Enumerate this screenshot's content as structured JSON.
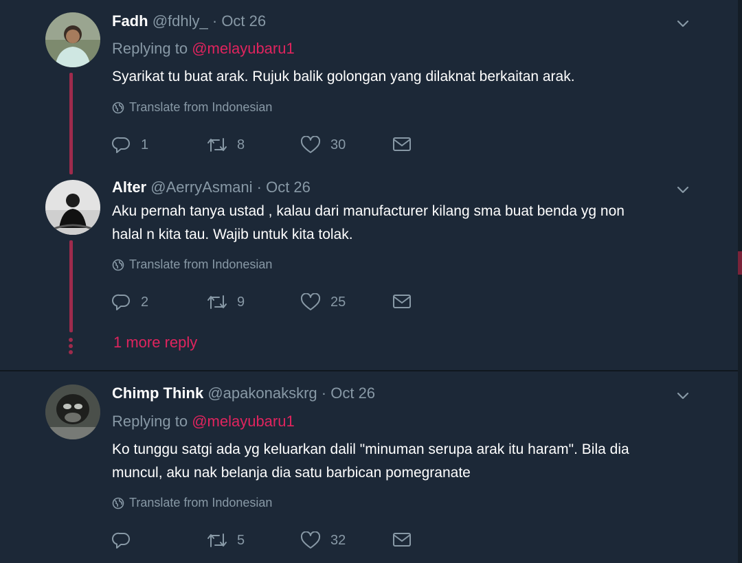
{
  "tweets": [
    {
      "name": "Fadh",
      "handle": "@fdhly_",
      "sep": "·",
      "date": "Oct 26",
      "replying_prefix": "Replying to ",
      "replying_to": "@melayubaru1",
      "text": "Syarikat tu buat arak. Rujuk balik golongan yang dilaknat berkaitan arak.",
      "translate": "Translate from Indonesian",
      "replies": "1",
      "retweets": "8",
      "likes": "30"
    },
    {
      "name": "Alter",
      "handle": "@AerryAsmani",
      "sep": "·",
      "date": "Oct 26",
      "text_line1": "Aku pernah tanya ustad , kalau dari manufacturer  kilang sma buat benda yg non",
      "text_line2": "halal n kita tau. Wajib untuk kita tolak.",
      "translate": "Translate from Indonesian",
      "replies": "2",
      "retweets": "9",
      "likes": "25"
    },
    {
      "name": "Chimp Think",
      "handle": "@apakonakskrg",
      "sep": "·",
      "date": "Oct 26",
      "replying_prefix": "Replying to ",
      "replying_to": "@melayubaru1",
      "text_line1": "Ko tunggu satgi ada yg keluarkan dalil \"minuman serupa arak itu haram\". Bila dia",
      "text_line2": "muncul, aku nak belanja dia satu barbican pomegranate",
      "translate": "Translate from Indonesian",
      "replies": "",
      "retweets": "5",
      "likes": "32"
    }
  ],
  "more_reply": "1 more reply",
  "colors": {
    "background": "#1c2837",
    "accent": "#e0245e",
    "muted": "#8899a6",
    "thread": "#9e2b4c"
  },
  "icons": [
    "chevron-down-icon",
    "globe-icon",
    "reply-icon",
    "retweet-icon",
    "like-icon",
    "message-icon"
  ]
}
